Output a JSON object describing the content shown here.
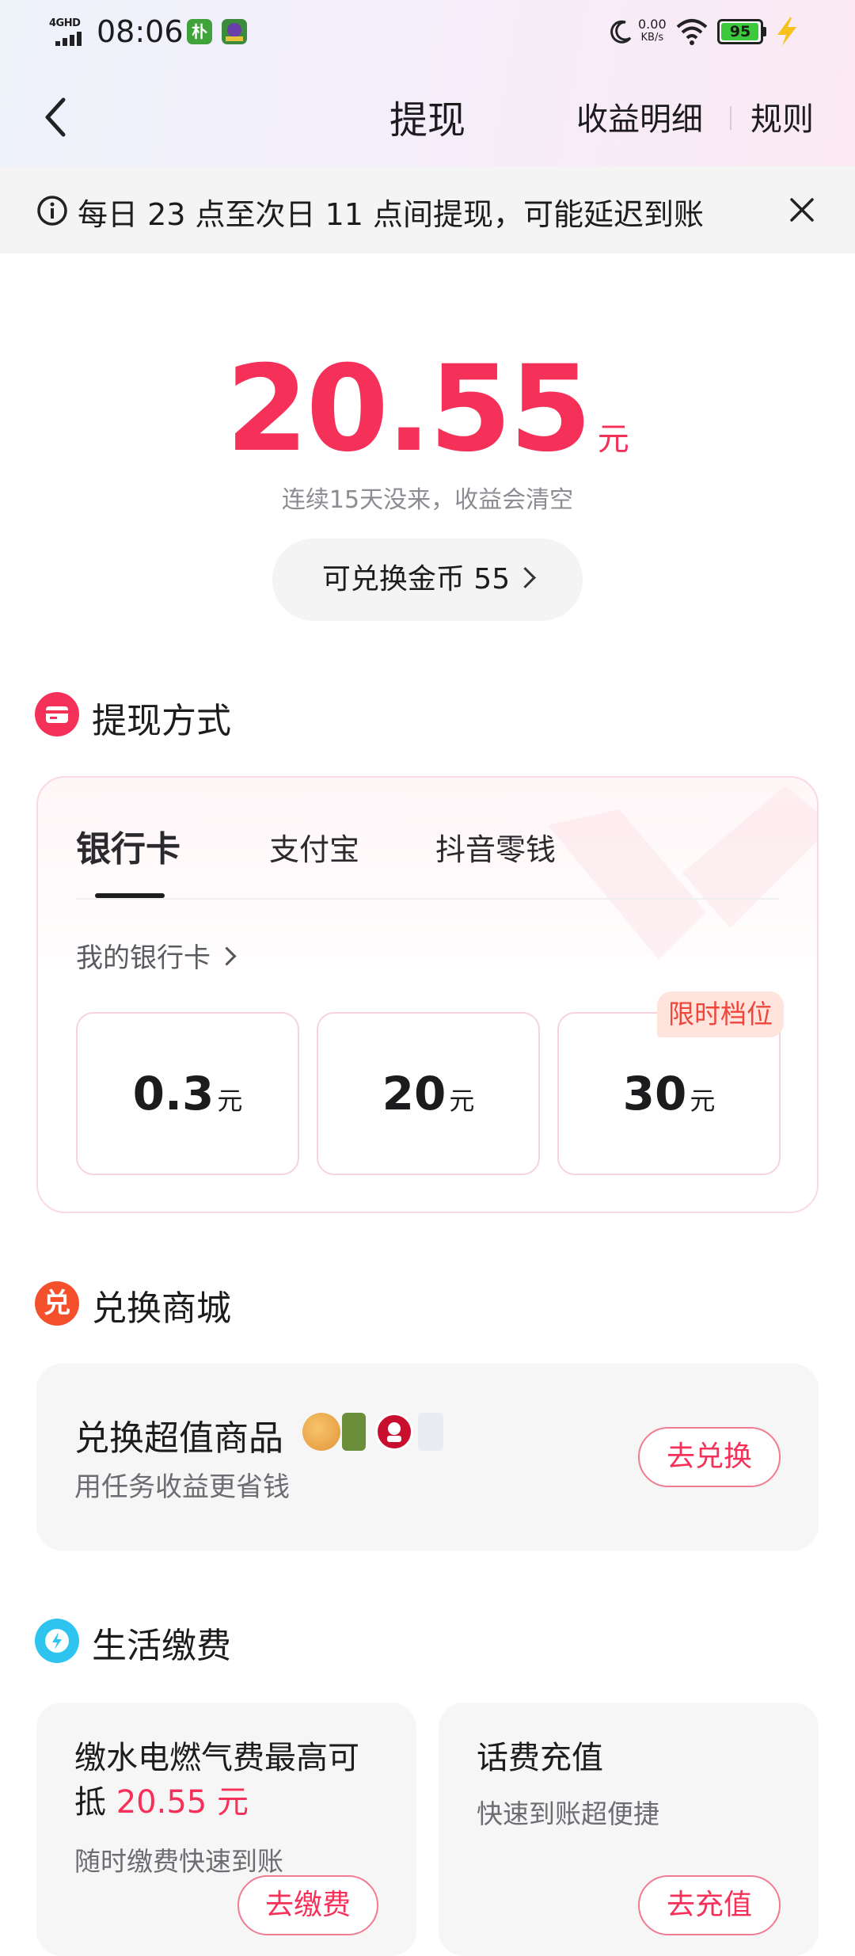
{
  "status_bar": {
    "network": "4GHD",
    "time": "08:06",
    "app_icon_1": "朴",
    "speed_value": "0.00",
    "speed_unit": "KB/s",
    "battery": "95"
  },
  "nav": {
    "title": "提现",
    "detail_link": "收益明细",
    "rules_link": "规则"
  },
  "notice": {
    "text": "每日 23 点至次日 11 点间提现，可能延迟到账"
  },
  "balance": {
    "amount": "20.55",
    "unit": "元",
    "tip": "连续15天没来，收益会清空",
    "coins_label": "可兑换金币 55"
  },
  "withdraw": {
    "section_title": "提现方式",
    "tabs": [
      {
        "label": "银行卡",
        "active": true
      },
      {
        "label": "支付宝",
        "active": false
      },
      {
        "label": "抖音零钱",
        "active": false
      }
    ],
    "my_card_label": "我的银行卡",
    "amounts": [
      {
        "value": "0.3",
        "unit": "元"
      },
      {
        "value": "20",
        "unit": "元"
      },
      {
        "value": "30",
        "unit": "元"
      }
    ],
    "badge": "限时档位"
  },
  "exchange": {
    "section_title": "兑换商城",
    "icon_text": "兑",
    "card_title": "兑换超值商品",
    "card_sub": "用任务收益更省钱",
    "button": "去兑换"
  },
  "life": {
    "section_title": "生活缴费",
    "cards": [
      {
        "title_line1": "缴水电燃气费最高可",
        "title_line2_prefix": "抵 ",
        "title_line2_highlight": "20.55 元",
        "sub": "随时缴费快速到账",
        "button": "去缴费"
      },
      {
        "title": "话费充值",
        "sub": "快速到账超便捷",
        "button": "去充值"
      }
    ]
  },
  "colors": {
    "accent": "#f5315a",
    "badge_text": "#f0463a",
    "exchange_icon": "#f4502b",
    "life_icon": "#2ec4f0"
  }
}
